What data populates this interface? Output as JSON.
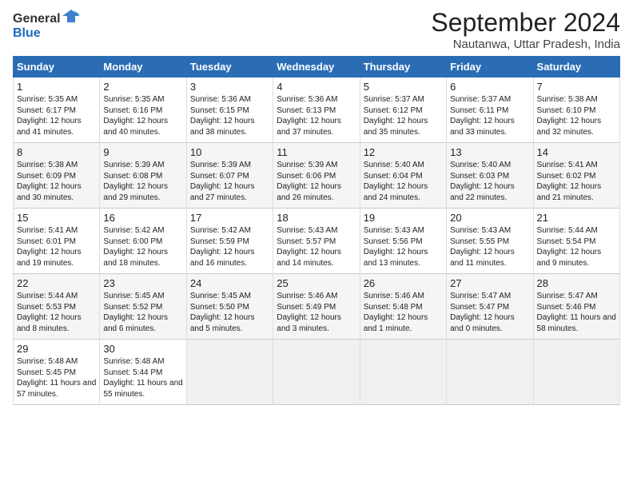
{
  "header": {
    "logo_general": "General",
    "logo_blue": "Blue",
    "title": "September 2024",
    "subtitle": "Nautanwa, Uttar Pradesh, India"
  },
  "days_of_week": [
    "Sunday",
    "Monday",
    "Tuesday",
    "Wednesday",
    "Thursday",
    "Friday",
    "Saturday"
  ],
  "weeks": [
    [
      {
        "day": "1",
        "sunrise": "5:35 AM",
        "sunset": "6:17 PM",
        "daylight": "12 hours and 41 minutes."
      },
      {
        "day": "2",
        "sunrise": "5:35 AM",
        "sunset": "6:16 PM",
        "daylight": "12 hours and 40 minutes."
      },
      {
        "day": "3",
        "sunrise": "5:36 AM",
        "sunset": "6:15 PM",
        "daylight": "12 hours and 38 minutes."
      },
      {
        "day": "4",
        "sunrise": "5:36 AM",
        "sunset": "6:13 PM",
        "daylight": "12 hours and 37 minutes."
      },
      {
        "day": "5",
        "sunrise": "5:37 AM",
        "sunset": "6:12 PM",
        "daylight": "12 hours and 35 minutes."
      },
      {
        "day": "6",
        "sunrise": "5:37 AM",
        "sunset": "6:11 PM",
        "daylight": "12 hours and 33 minutes."
      },
      {
        "day": "7",
        "sunrise": "5:38 AM",
        "sunset": "6:10 PM",
        "daylight": "12 hours and 32 minutes."
      }
    ],
    [
      {
        "day": "8",
        "sunrise": "5:38 AM",
        "sunset": "6:09 PM",
        "daylight": "12 hours and 30 minutes."
      },
      {
        "day": "9",
        "sunrise": "5:39 AM",
        "sunset": "6:08 PM",
        "daylight": "12 hours and 29 minutes."
      },
      {
        "day": "10",
        "sunrise": "5:39 AM",
        "sunset": "6:07 PM",
        "daylight": "12 hours and 27 minutes."
      },
      {
        "day": "11",
        "sunrise": "5:39 AM",
        "sunset": "6:06 PM",
        "daylight": "12 hours and 26 minutes."
      },
      {
        "day": "12",
        "sunrise": "5:40 AM",
        "sunset": "6:04 PM",
        "daylight": "12 hours and 24 minutes."
      },
      {
        "day": "13",
        "sunrise": "5:40 AM",
        "sunset": "6:03 PM",
        "daylight": "12 hours and 22 minutes."
      },
      {
        "day": "14",
        "sunrise": "5:41 AM",
        "sunset": "6:02 PM",
        "daylight": "12 hours and 21 minutes."
      }
    ],
    [
      {
        "day": "15",
        "sunrise": "5:41 AM",
        "sunset": "6:01 PM",
        "daylight": "12 hours and 19 minutes."
      },
      {
        "day": "16",
        "sunrise": "5:42 AM",
        "sunset": "6:00 PM",
        "daylight": "12 hours and 18 minutes."
      },
      {
        "day": "17",
        "sunrise": "5:42 AM",
        "sunset": "5:59 PM",
        "daylight": "12 hours and 16 minutes."
      },
      {
        "day": "18",
        "sunrise": "5:43 AM",
        "sunset": "5:57 PM",
        "daylight": "12 hours and 14 minutes."
      },
      {
        "day": "19",
        "sunrise": "5:43 AM",
        "sunset": "5:56 PM",
        "daylight": "12 hours and 13 minutes."
      },
      {
        "day": "20",
        "sunrise": "5:43 AM",
        "sunset": "5:55 PM",
        "daylight": "12 hours and 11 minutes."
      },
      {
        "day": "21",
        "sunrise": "5:44 AM",
        "sunset": "5:54 PM",
        "daylight": "12 hours and 9 minutes."
      }
    ],
    [
      {
        "day": "22",
        "sunrise": "5:44 AM",
        "sunset": "5:53 PM",
        "daylight": "12 hours and 8 minutes."
      },
      {
        "day": "23",
        "sunrise": "5:45 AM",
        "sunset": "5:52 PM",
        "daylight": "12 hours and 6 minutes."
      },
      {
        "day": "24",
        "sunrise": "5:45 AM",
        "sunset": "5:50 PM",
        "daylight": "12 hours and 5 minutes."
      },
      {
        "day": "25",
        "sunrise": "5:46 AM",
        "sunset": "5:49 PM",
        "daylight": "12 hours and 3 minutes."
      },
      {
        "day": "26",
        "sunrise": "5:46 AM",
        "sunset": "5:48 PM",
        "daylight": "12 hours and 1 minute."
      },
      {
        "day": "27",
        "sunrise": "5:47 AM",
        "sunset": "5:47 PM",
        "daylight": "12 hours and 0 minutes."
      },
      {
        "day": "28",
        "sunrise": "5:47 AM",
        "sunset": "5:46 PM",
        "daylight": "11 hours and 58 minutes."
      }
    ],
    [
      {
        "day": "29",
        "sunrise": "5:48 AM",
        "sunset": "5:45 PM",
        "daylight": "11 hours and 57 minutes."
      },
      {
        "day": "30",
        "sunrise": "5:48 AM",
        "sunset": "5:44 PM",
        "daylight": "11 hours and 55 minutes."
      },
      null,
      null,
      null,
      null,
      null
    ]
  ]
}
